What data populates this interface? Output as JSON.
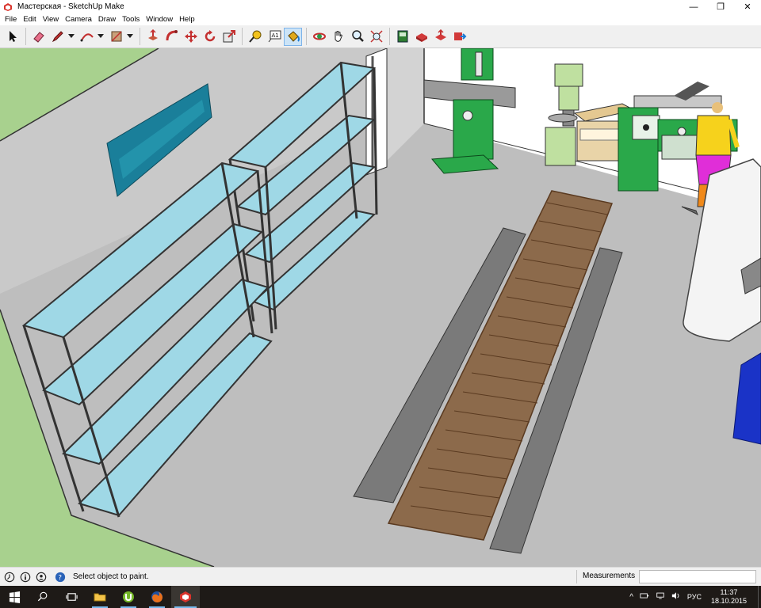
{
  "window": {
    "title": "Мастерская - SketchUp Make",
    "controls": [
      "—",
      "❐",
      "✕"
    ]
  },
  "menu": [
    "File",
    "Edit",
    "View",
    "Camera",
    "Draw",
    "Tools",
    "Window",
    "Help"
  ],
  "toolbar": {
    "tools": [
      {
        "name": "select-tool",
        "icon": "arrow-cursor-icon"
      },
      {
        "name": "eraser-tool",
        "icon": "eraser-icon"
      },
      {
        "name": "line-tool",
        "icon": "pencil-icon"
      },
      {
        "name": "arc-tool",
        "icon": "arc-icon"
      },
      {
        "name": "rectangle-tool",
        "icon": "rectangle-icon"
      },
      {
        "name": "push-pull-tool",
        "icon": "push-pull-icon"
      },
      {
        "name": "follow-me-tool",
        "icon": "follow-me-icon"
      },
      {
        "name": "move-tool",
        "icon": "move-icon"
      },
      {
        "name": "rotate-tool",
        "icon": "rotate-icon"
      },
      {
        "name": "scale-tool",
        "icon": "scale-icon"
      },
      {
        "name": "tape-measure-tool",
        "icon": "tape-measure-icon"
      },
      {
        "name": "text-tool",
        "icon": "text-icon"
      },
      {
        "name": "paint-bucket-tool",
        "icon": "paint-bucket-icon",
        "active": true
      },
      {
        "name": "orbit-tool",
        "icon": "orbit-icon"
      },
      {
        "name": "pan-tool",
        "icon": "hand-icon"
      },
      {
        "name": "zoom-tool",
        "icon": "magnifier-icon"
      },
      {
        "name": "zoom-extents-tool",
        "icon": "zoom-extents-icon"
      },
      {
        "name": "warehouse-tool",
        "icon": "warehouse-icon"
      },
      {
        "name": "get-models-tool",
        "icon": "get-models-icon"
      },
      {
        "name": "share-model-tool",
        "icon": "share-model-icon"
      },
      {
        "name": "extension-warehouse-tool",
        "icon": "extension-icon"
      }
    ],
    "text_tool_glyph": "A1"
  },
  "statusbar": {
    "message": "Select object to paint.",
    "measurements_label": "Measurements",
    "measurements_value": ""
  },
  "taskbar": {
    "apps": [
      "start-icon",
      "search-icon",
      "task-view-icon",
      "file-explorer-icon",
      "utorrent-icon",
      "firefox-icon",
      "sketchup-icon"
    ],
    "tray": {
      "chevron": "^",
      "language": "РУС",
      "time": "11:37",
      "date": "18.10.2015"
    }
  },
  "colors": {
    "floor": "#bebebe",
    "wall_left": "#a8d18e",
    "wall_back": "#c9c9c9",
    "glass": "#9fd8e6",
    "frame": "#3a3a3a",
    "wood": "#8c6a4b",
    "brick": "#7a7a7a",
    "machine_green": "#2aa84a",
    "column": "#f4f4f4",
    "blue_object": "#1a33c7"
  }
}
